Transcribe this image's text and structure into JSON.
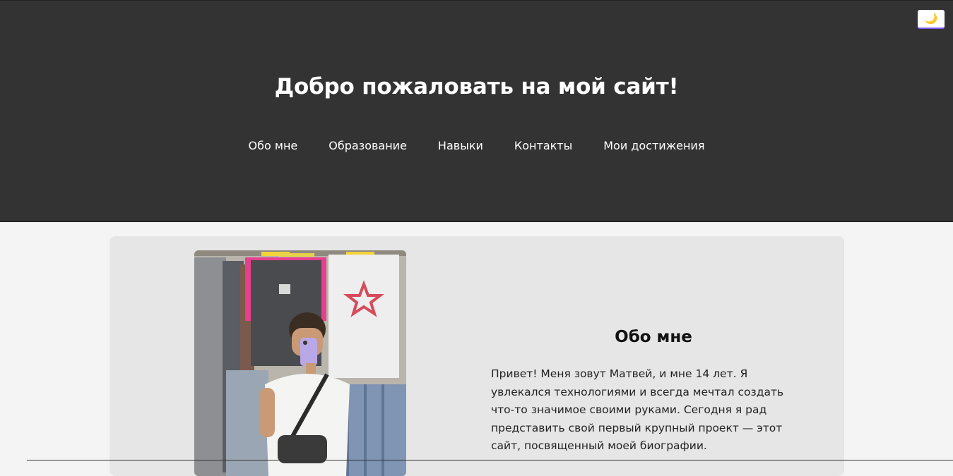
{
  "header": {
    "theme_toggle_icon": "🌙",
    "title": "Добро пожаловать на мой сайт!"
  },
  "nav": {
    "items": [
      {
        "label": "Обо мне"
      },
      {
        "label": "Образование"
      },
      {
        "label": "Навыки"
      },
      {
        "label": "Контакты"
      },
      {
        "label": "Мои достижения"
      }
    ]
  },
  "about": {
    "title": "Обо мне",
    "text": "Привет! Меня зовут Матвей, и мне 14 лет. Я увлекался технологиями и всегда мечтал создать что-то значимое своими руками. Сегодня я рад представить свой первый крупный проект — этот сайт, посвященный моей биографии."
  },
  "colors": {
    "header_bg": "#333333",
    "page_bg": "#f4f4f4",
    "card_bg": "#e6e6e6",
    "toggle_accent": "#7b5cff"
  }
}
